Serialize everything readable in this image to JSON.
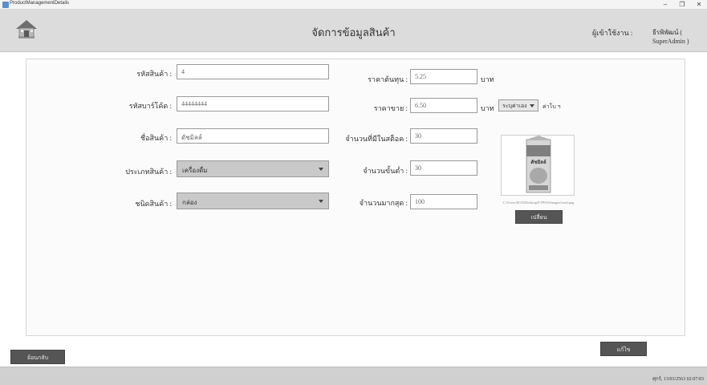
{
  "window": {
    "title": "ProductManagementDetails",
    "minimize": "–",
    "maximize": "❐",
    "close": "✕"
  },
  "header": {
    "title": "จัดการข้อมูลสินค้า",
    "user_label": "ผู้เข้าใช้งาน :",
    "user_name": "ธีรพิพัฒน์ ( SuperAdmin )"
  },
  "form": {
    "product_id": {
      "label": "รหัสสินค้า :",
      "value": "4"
    },
    "barcode": {
      "label": "รหัสบาร์โค้ด :",
      "value": "44444444"
    },
    "product_name": {
      "label": "ชื่อสินค้า :",
      "value": "ดัชมิลล์"
    },
    "category": {
      "label": "ประเภทสินค้า :",
      "value": "เครื่องดื่ม"
    },
    "product_type": {
      "label": "ชนิดสินค้า :",
      "value": "กล่อง"
    },
    "cost": {
      "label": "ราคาต้นทุน :",
      "value": "5.25",
      "unit": "บาท"
    },
    "price": {
      "label": "ราคาขาย :",
      "value": "6.50",
      "unit": "บาท",
      "option": "ระบุค่าเอง",
      "suffix": "ค่าโบ ฯ"
    },
    "stock": {
      "label": "จำนวนที่มีในสต็อค :",
      "value": "30"
    },
    "min_qty": {
      "label": "จำนวนขั้นต่ำ :",
      "value": "30"
    },
    "max_qty": {
      "label": "จำนวนมากสุด :",
      "value": "100"
    }
  },
  "image": {
    "path": "C:\\Users\\EGN\\Desktop\\FTPOS\\Images\\food.png",
    "change_label": "เปลี่ยน",
    "product_text": "ดัชมิลล์"
  },
  "buttons": {
    "back": "ย้อนกลับ",
    "edit": "แก้ไข"
  },
  "status": {
    "datetime": "ศุกร์, 13/03/2563 02:07:03"
  },
  "colors": {
    "header_bg": "#dcdcdc",
    "footer_bg": "#d0d0d0",
    "button_dark": "#555555"
  }
}
